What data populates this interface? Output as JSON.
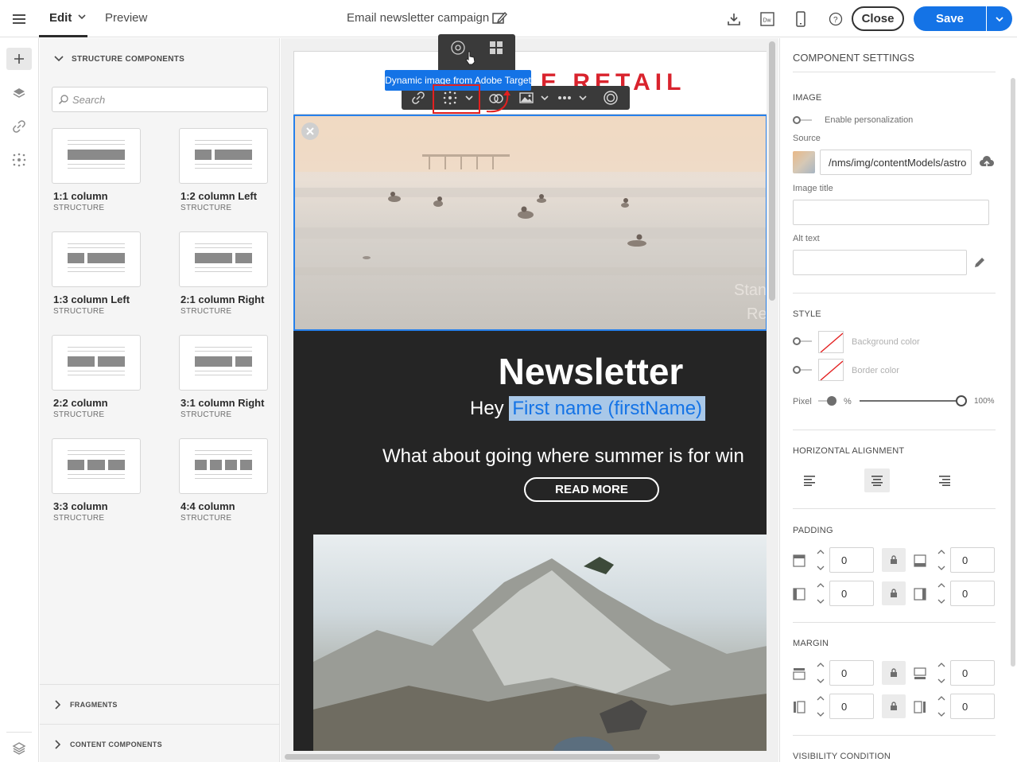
{
  "header": {
    "menu_icon": "hamburger-menu-icon",
    "tab_edit": "Edit",
    "tab_preview": "Preview",
    "title": "Email newsletter campaign",
    "close_label": "Close",
    "save_label": "Save",
    "accent": "#1473e6"
  },
  "rail": {
    "icons": [
      "plus-icon",
      "layers-icon",
      "link-icon",
      "personalization-icon",
      "stack-settings-icon"
    ]
  },
  "components": {
    "header": "STRUCTURE COMPONENTS",
    "search_placeholder": "Search",
    "items": [
      {
        "label": "1:1 column",
        "sub": "STRUCTURE"
      },
      {
        "label": "1:2 column Left",
        "sub": "STRUCTURE"
      },
      {
        "label": "1:3 column Left",
        "sub": "STRUCTURE"
      },
      {
        "label": "2:1 column Right",
        "sub": "STRUCTURE"
      },
      {
        "label": "2:2 column",
        "sub": "STRUCTURE"
      },
      {
        "label": "3:1 column Right",
        "sub": "STRUCTURE"
      },
      {
        "label": "3:3 column",
        "sub": "STRUCTURE"
      },
      {
        "label": "4:4 column",
        "sub": "STRUCTURE"
      }
    ],
    "fragments": "FRAGMENTS",
    "content_components": "CONTENT COMPONENTS"
  },
  "canvas": {
    "logo_text": "E RETAIL",
    "logo_color": "#d9232d",
    "hero_overlay_1": "Stan",
    "hero_overlay_2": "Re",
    "newsletter_title": "Newsletter",
    "greeting": "Hey",
    "first_name_tag": "First name (firstName)",
    "tagline": "What about going where summer is for win",
    "read_more": "READ MORE",
    "tooltip": "Dynamic image from Adobe Target"
  },
  "settings": {
    "title": "COMPONENT SETTINGS",
    "image_section": "IMAGE",
    "enable_personalization": "Enable personalization",
    "source_label": "Source",
    "source_value": "/nms/img/contentModels/astro",
    "image_title_label": "Image title",
    "alt_text_label": "Alt text",
    "style_section": "STYLE",
    "background_color": "Background color",
    "border_color": "Border color",
    "pixel_label": "Pixel",
    "percent_label": "%",
    "width_value": "100%",
    "width_fraction": 1.0,
    "horizontal_alignment": "HORIZONTAL ALIGNMENT",
    "padding_section": "PADDING",
    "padding_values": [
      "0",
      "0",
      "0",
      "0"
    ],
    "margin_section": "MARGIN",
    "margin_values": [
      "0",
      "0",
      "0",
      "0"
    ],
    "visibility_condition": "VISIBILITY CONDITION"
  }
}
